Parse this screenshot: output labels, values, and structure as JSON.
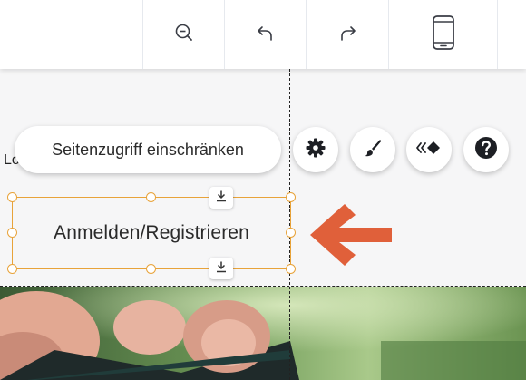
{
  "toolbar": {
    "buttons": [
      {
        "name": "zoom-out",
        "icon": "zoom-out-icon"
      },
      {
        "name": "undo",
        "icon": "undo-icon"
      },
      {
        "name": "redo",
        "icon": "redo-icon"
      },
      {
        "name": "mobile-view",
        "icon": "mobile-device-icon"
      }
    ]
  },
  "canvas": {
    "partial_text": "Lo",
    "tooltip": "Seitenzugriff einschränken",
    "selected_element_label": "Anmelden/Registrieren",
    "action_buttons": [
      {
        "name": "settings",
        "icon": "gear-icon"
      },
      {
        "name": "design",
        "icon": "paintbrush-icon"
      },
      {
        "name": "animation",
        "icon": "animation-icon"
      },
      {
        "name": "help",
        "icon": "question-icon"
      }
    ],
    "pointer": {
      "icon": "arrow-left-icon",
      "color": "#e0603a"
    }
  },
  "colors": {
    "selection": "#e8a33a",
    "accent_arrow": "#e0603a"
  }
}
